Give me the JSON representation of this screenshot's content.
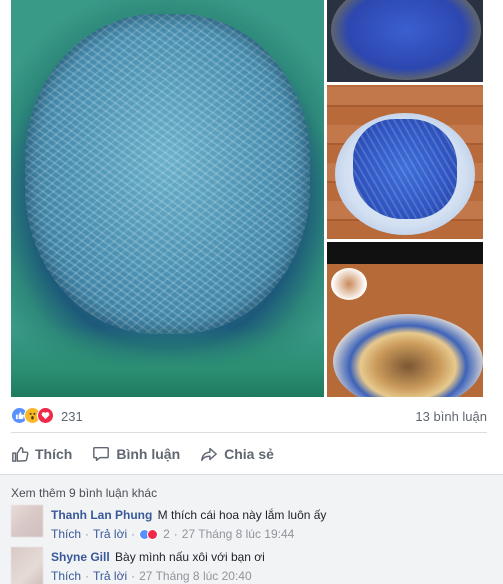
{
  "post": {
    "reactions": {
      "icons": [
        "like-icon",
        "wow-icon",
        "love-icon"
      ],
      "count": "231"
    },
    "comment_count_label": "13 bình luận",
    "actions": {
      "like_label": "Thích",
      "comment_label": "Bình luận",
      "share_label": "Chia sẻ"
    }
  },
  "comments_section": {
    "view_more_label": "Xem thêm 9 bình luận khác",
    "comments": [
      {
        "author": "Thanh Lan Phung",
        "text": "M thích cái hoa này lắm luôn ấy",
        "like_label": "Thích",
        "reply_label": "Trả lời",
        "reaction_count": "2",
        "timestamp": "27 Tháng 8 lúc 19:44"
      },
      {
        "author": "Shyne Gill",
        "text": "Bày mình nấu xôi với bạn ơi",
        "like_label": "Thích",
        "reply_label": "Trả lời",
        "timestamp": "27 Tháng 8 lúc 20:40"
      }
    ]
  },
  "colors": {
    "link": "#385898",
    "muted": "#606770",
    "like": "#5890ff",
    "love": "#f0284a",
    "wow": "#f7b928"
  }
}
